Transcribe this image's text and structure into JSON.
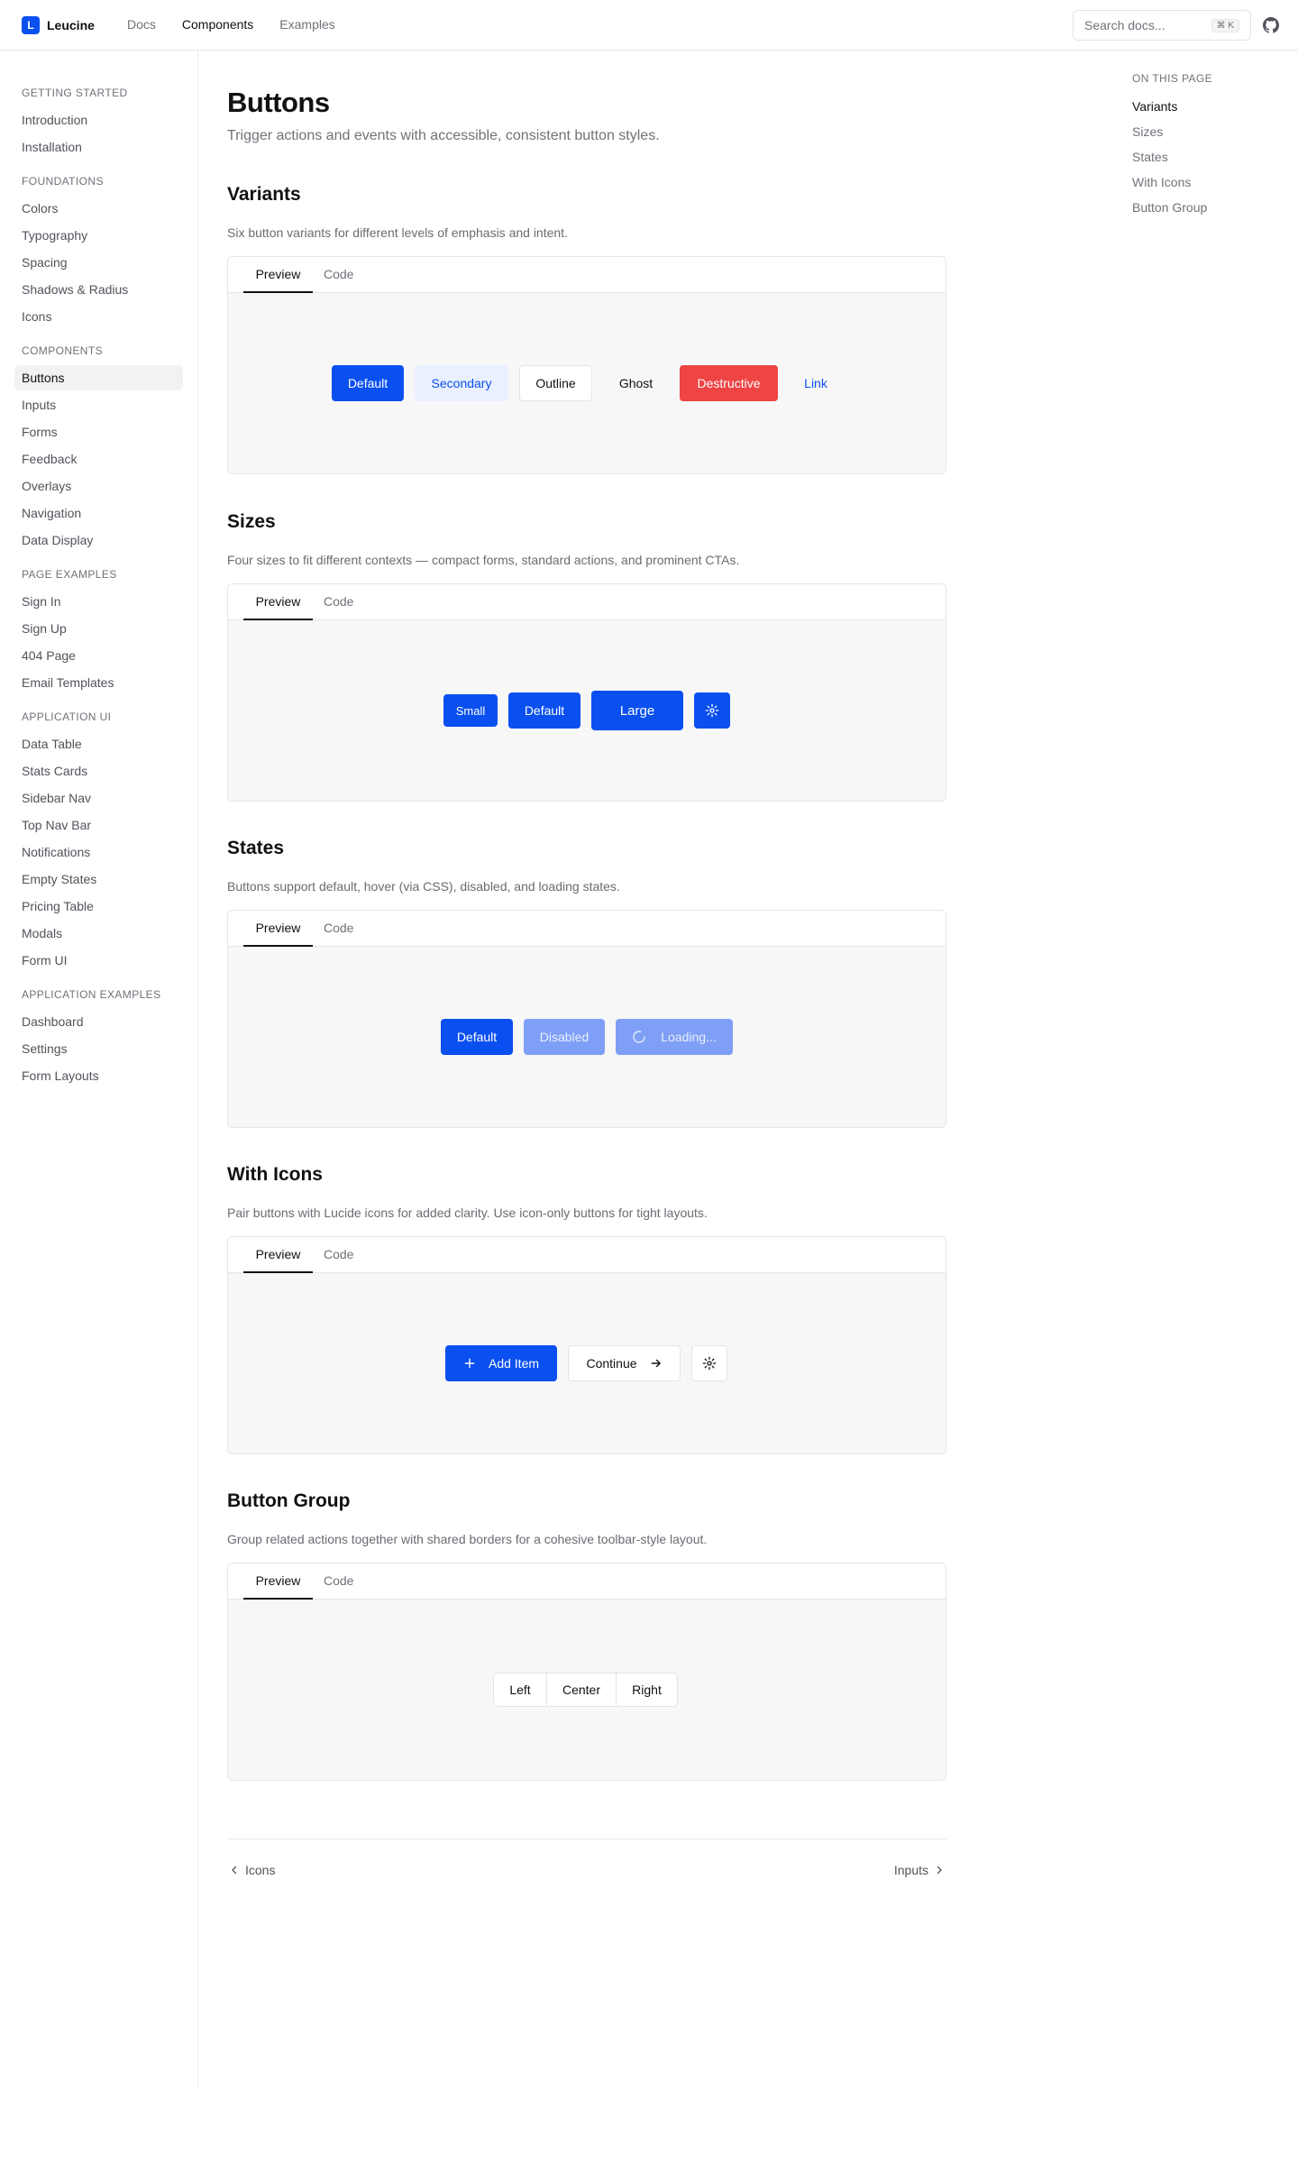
{
  "header": {
    "logo_letter": "L",
    "brand": "Leucine",
    "nav": [
      "Docs",
      "Components",
      "Examples"
    ],
    "active_nav": "Components",
    "search_placeholder": "Search docs...",
    "search_shortcut": "⌘ K"
  },
  "sidebar": {
    "groups": [
      {
        "label": "GETTING STARTED",
        "items": [
          "Introduction",
          "Installation"
        ]
      },
      {
        "label": "FOUNDATIONS",
        "items": [
          "Colors",
          "Typography",
          "Spacing",
          "Shadows & Radius",
          "Icons"
        ]
      },
      {
        "label": "COMPONENTS",
        "items": [
          "Buttons",
          "Inputs",
          "Forms",
          "Feedback",
          "Overlays",
          "Navigation",
          "Data Display"
        ]
      },
      {
        "label": "PAGE EXAMPLES",
        "items": [
          "Sign In",
          "Sign Up",
          "404 Page",
          "Email Templates"
        ]
      },
      {
        "label": "APPLICATION UI",
        "items": [
          "Data Table",
          "Stats Cards",
          "Sidebar Nav",
          "Top Nav Bar",
          "Notifications",
          "Empty States",
          "Pricing Table",
          "Modals",
          "Form UI"
        ]
      },
      {
        "label": "APPLICATION EXAMPLES",
        "items": [
          "Dashboard",
          "Settings",
          "Form Layouts"
        ]
      }
    ],
    "active_item": "Buttons"
  },
  "page": {
    "title": "Buttons",
    "subtitle": "Trigger actions and events with accessible, consistent button styles."
  },
  "tabs": {
    "preview": "Preview",
    "code": "Code"
  },
  "sections": {
    "variants": {
      "title": "Variants",
      "desc": "Six button variants for different levels of emphasis and intent.",
      "buttons": {
        "default": "Default",
        "secondary": "Secondary",
        "outline": "Outline",
        "ghost": "Ghost",
        "destructive": "Destructive",
        "link": "Link"
      }
    },
    "sizes": {
      "title": "Sizes",
      "desc": "Four sizes to fit different contexts — compact forms, standard actions, and prominent CTAs.",
      "buttons": {
        "small": "Small",
        "default": "Default",
        "large": "Large",
        "icon": "settings-icon"
      }
    },
    "states": {
      "title": "States",
      "desc": "Buttons support default, hover (via CSS), disabled, and loading states.",
      "buttons": {
        "default": "Default",
        "disabled": "Disabled",
        "loading": "Loading..."
      }
    },
    "with_icons": {
      "title": "With Icons",
      "desc": "Pair buttons with Lucide icons for added clarity. Use icon-only buttons for tight layouts.",
      "buttons": {
        "add": "Add Item",
        "continue": "Continue",
        "icon": "settings-icon"
      }
    },
    "button_group": {
      "title": "Button Group",
      "desc": "Group related actions together with shared borders for a cohesive toolbar-style layout.",
      "buttons": [
        "Left",
        "Center",
        "Right"
      ]
    }
  },
  "pager": {
    "prev": "Icons",
    "next": "Inputs"
  },
  "toc": {
    "label": "ON THIS PAGE",
    "items": [
      "Variants",
      "Sizes",
      "States",
      "With Icons",
      "Button Group"
    ],
    "active": "Variants"
  },
  "colors": {
    "primary": "#0a4ff0",
    "destructive": "#ee4444",
    "secondary_bg": "#eaf0ff"
  }
}
